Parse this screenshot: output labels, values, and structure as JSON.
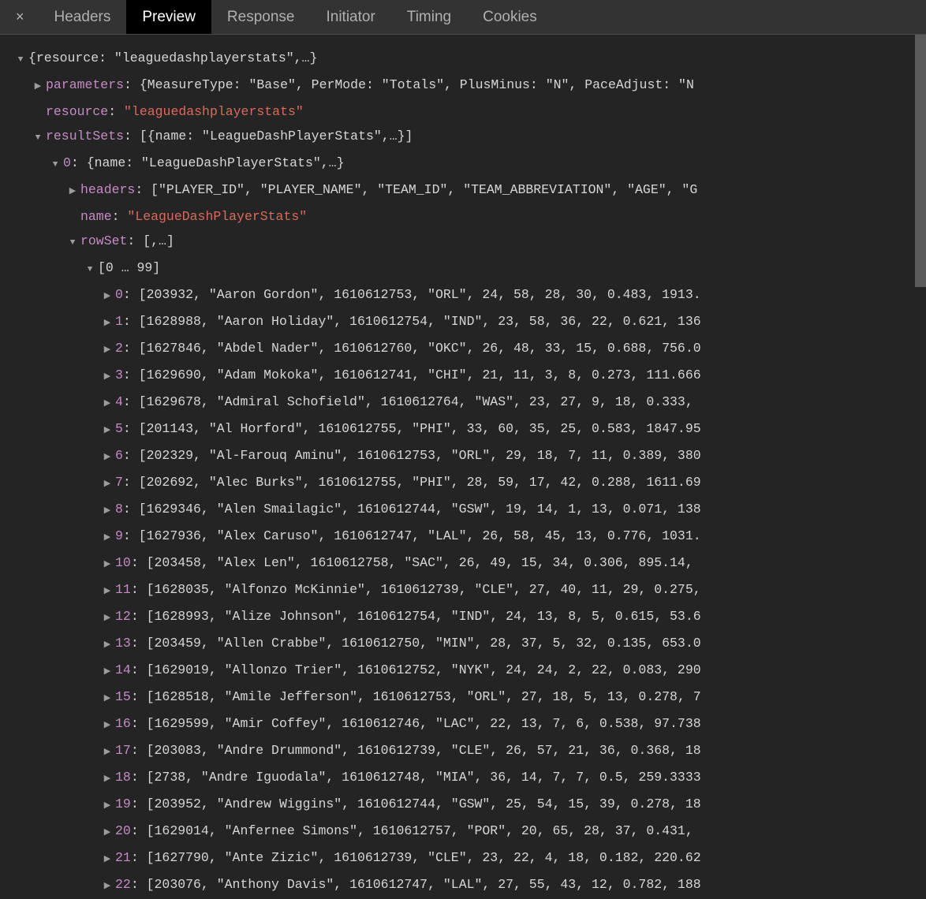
{
  "tabs": {
    "close_glyph": "×",
    "headers": "Headers",
    "preview": "Preview",
    "response": "Response",
    "initiator": "Initiator",
    "timing": "Timing",
    "cookies": "Cookies"
  },
  "root_preview": "{resource: \"leaguedashplayerstats\",…}",
  "parameters": {
    "key": "parameters",
    "preview": "{MeasureType: \"Base\", PerMode: \"Totals\", PlusMinus: \"N\", PaceAdjust: \"N"
  },
  "resource": {
    "key": "resource",
    "value": "\"leaguedashplayerstats\""
  },
  "resultSets": {
    "key": "resultSets",
    "preview": "[{name: \"LeagueDashPlayerStats\",…}]"
  },
  "rs0": {
    "key": "0",
    "preview": "{name: \"LeagueDashPlayerStats\",…}"
  },
  "headers": {
    "key": "headers",
    "preview": "[\"PLAYER_ID\", \"PLAYER_NAME\", \"TEAM_ID\", \"TEAM_ABBREVIATION\", \"AGE\", \"G"
  },
  "name": {
    "key": "name",
    "value": "\"LeagueDashPlayerStats\""
  },
  "rowSet": {
    "key": "rowSet",
    "preview": "[,…]"
  },
  "bucket": "[0 … 99]",
  "rows": [
    {
      "idx": "0",
      "text": "[203932, \"Aaron Gordon\", 1610612753, \"ORL\", 24, 58, 28, 30, 0.483, 1913."
    },
    {
      "idx": "1",
      "text": "[1628988, \"Aaron Holiday\", 1610612754, \"IND\", 23, 58, 36, 22, 0.621, 136"
    },
    {
      "idx": "2",
      "text": "[1627846, \"Abdel Nader\", 1610612760, \"OKC\", 26, 48, 33, 15, 0.688, 756.0"
    },
    {
      "idx": "3",
      "text": "[1629690, \"Adam Mokoka\", 1610612741, \"CHI\", 21, 11, 3, 8, 0.273, 111.666"
    },
    {
      "idx": "4",
      "text": "[1629678, \"Admiral Schofield\", 1610612764, \"WAS\", 23, 27, 9, 18, 0.333, "
    },
    {
      "idx": "5",
      "text": "[201143, \"Al Horford\", 1610612755, \"PHI\", 33, 60, 35, 25, 0.583, 1847.95"
    },
    {
      "idx": "6",
      "text": "[202329, \"Al-Farouq Aminu\", 1610612753, \"ORL\", 29, 18, 7, 11, 0.389, 380"
    },
    {
      "idx": "7",
      "text": "[202692, \"Alec Burks\", 1610612755, \"PHI\", 28, 59, 17, 42, 0.288, 1611.69"
    },
    {
      "idx": "8",
      "text": "[1629346, \"Alen Smailagic\", 1610612744, \"GSW\", 19, 14, 1, 13, 0.071, 138"
    },
    {
      "idx": "9",
      "text": "[1627936, \"Alex Caruso\", 1610612747, \"LAL\", 26, 58, 45, 13, 0.776, 1031."
    },
    {
      "idx": "10",
      "text": "[203458, \"Alex Len\", 1610612758, \"SAC\", 26, 49, 15, 34, 0.306, 895.14, "
    },
    {
      "idx": "11",
      "text": "[1628035, \"Alfonzo McKinnie\", 1610612739, \"CLE\", 27, 40, 11, 29, 0.275,"
    },
    {
      "idx": "12",
      "text": "[1628993, \"Alize Johnson\", 1610612754, \"IND\", 24, 13, 8, 5, 0.615, 53.6"
    },
    {
      "idx": "13",
      "text": "[203459, \"Allen Crabbe\", 1610612750, \"MIN\", 28, 37, 5, 32, 0.135, 653.0"
    },
    {
      "idx": "14",
      "text": "[1629019, \"Allonzo Trier\", 1610612752, \"NYK\", 24, 24, 2, 22, 0.083, 290"
    },
    {
      "idx": "15",
      "text": "[1628518, \"Amile Jefferson\", 1610612753, \"ORL\", 27, 18, 5, 13, 0.278, 7"
    },
    {
      "idx": "16",
      "text": "[1629599, \"Amir Coffey\", 1610612746, \"LAC\", 22, 13, 7, 6, 0.538, 97.738"
    },
    {
      "idx": "17",
      "text": "[203083, \"Andre Drummond\", 1610612739, \"CLE\", 26, 57, 21, 36, 0.368, 18"
    },
    {
      "idx": "18",
      "text": "[2738, \"Andre Iguodala\", 1610612748, \"MIA\", 36, 14, 7, 7, 0.5, 259.3333"
    },
    {
      "idx": "19",
      "text": "[203952, \"Andrew Wiggins\", 1610612744, \"GSW\", 25, 54, 15, 39, 0.278, 18"
    },
    {
      "idx": "20",
      "text": "[1629014, \"Anfernee Simons\", 1610612757, \"POR\", 20, 65, 28, 37, 0.431, "
    },
    {
      "idx": "21",
      "text": "[1627790, \"Ante Zizic\", 1610612739, \"CLE\", 23, 22, 4, 18, 0.182, 220.62"
    },
    {
      "idx": "22",
      "text": "[203076, \"Anthony Davis\", 1610612747, \"LAL\", 27, 55, 43, 12, 0.782, 188"
    }
  ]
}
